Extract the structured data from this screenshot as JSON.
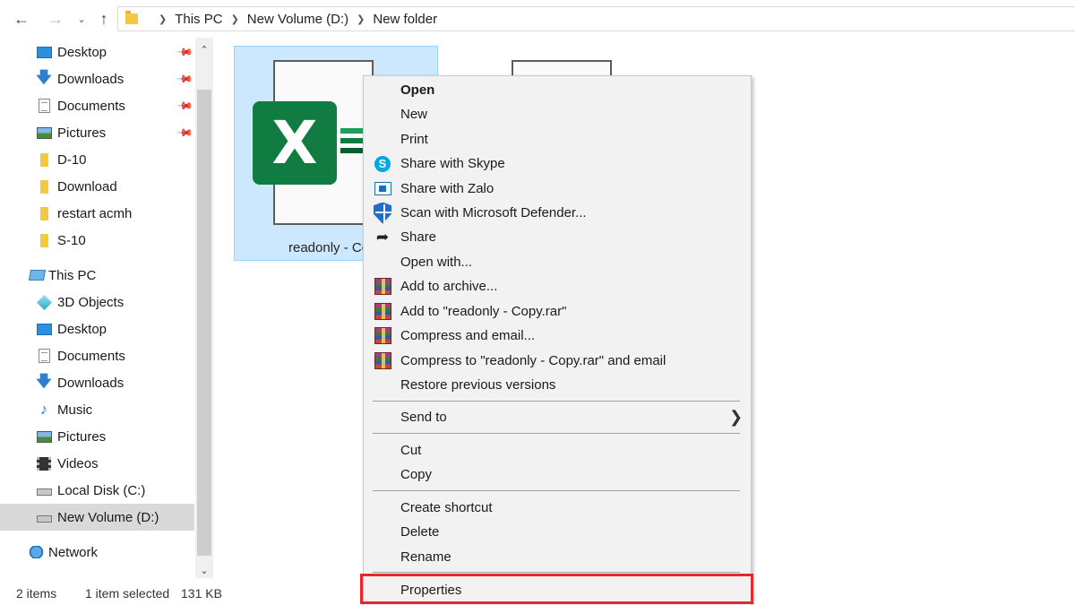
{
  "address_bar": {
    "back_icon": "back-arrow-icon",
    "forward_icon": "forward-arrow-icon",
    "up_icon": "up-arrow-icon",
    "breadcrumbs": [
      "This PC",
      "New Volume (D:)",
      "New folder"
    ]
  },
  "nav_pane": {
    "quick_access": [
      {
        "label": "Desktop",
        "icon": "desktop-icon",
        "pinned": true
      },
      {
        "label": "Downloads",
        "icon": "downloads-icon",
        "pinned": true
      },
      {
        "label": "Documents",
        "icon": "documents-icon",
        "pinned": true
      },
      {
        "label": "Pictures",
        "icon": "pictures-icon",
        "pinned": true
      },
      {
        "label": "D-10",
        "icon": "folder-icon",
        "pinned": false
      },
      {
        "label": "Download",
        "icon": "folder-icon",
        "pinned": false
      },
      {
        "label": "restart acmh",
        "icon": "folder-icon",
        "pinned": false
      },
      {
        "label": "S-10",
        "icon": "folder-icon",
        "pinned": false
      }
    ],
    "this_pc": {
      "label": "This PC",
      "icon": "this-pc-icon",
      "children": [
        {
          "label": "3D Objects",
          "icon": "3d-objects-icon"
        },
        {
          "label": "Desktop",
          "icon": "desktop-icon"
        },
        {
          "label": "Documents",
          "icon": "documents-icon"
        },
        {
          "label": "Downloads",
          "icon": "downloads-icon"
        },
        {
          "label": "Music",
          "icon": "music-icon"
        },
        {
          "label": "Pictures",
          "icon": "pictures-icon"
        },
        {
          "label": "Videos",
          "icon": "videos-icon"
        },
        {
          "label": "Local Disk (C:)",
          "icon": "local-disk-icon"
        },
        {
          "label": "New Volume (D:)",
          "icon": "drive-icon",
          "selected": true
        }
      ]
    },
    "network": {
      "label": "Network",
      "icon": "network-icon"
    }
  },
  "content": {
    "selected_file": {
      "name": "readonly - Co",
      "icon": "excel-file-icon",
      "badge_letter": "X"
    }
  },
  "context_menu": {
    "groups": [
      [
        {
          "label": "Open",
          "bold": true,
          "icon": null
        },
        {
          "label": "New",
          "icon": null
        },
        {
          "label": "Print",
          "icon": null
        },
        {
          "label": "Share with Skype",
          "icon": "skype-icon"
        },
        {
          "label": "Share with Zalo",
          "icon": "zalo-icon"
        },
        {
          "label": "Scan with Microsoft Defender...",
          "icon": "defender-shield-icon"
        },
        {
          "label": "Share",
          "icon": "share-icon"
        },
        {
          "label": "Open with...",
          "icon": null
        },
        {
          "label": "Add to archive...",
          "icon": "winrar-icon"
        },
        {
          "label": "Add to \"readonly - Copy.rar\"",
          "icon": "winrar-icon"
        },
        {
          "label": "Compress and email...",
          "icon": "winrar-icon"
        },
        {
          "label": "Compress to \"readonly - Copy.rar\" and email",
          "icon": "winrar-icon"
        },
        {
          "label": "Restore previous versions",
          "icon": null
        }
      ],
      [
        {
          "label": "Send to",
          "icon": null,
          "submenu": true
        }
      ],
      [
        {
          "label": "Cut",
          "icon": null
        },
        {
          "label": "Copy",
          "icon": null
        }
      ],
      [
        {
          "label": "Create shortcut",
          "icon": null
        },
        {
          "label": "Delete",
          "icon": null
        },
        {
          "label": "Rename",
          "icon": null
        }
      ],
      [
        {
          "label": "Properties",
          "icon": null,
          "highlighted": true
        }
      ]
    ],
    "highlight_color": "#e8262b"
  },
  "status_bar": {
    "items_count": "2 items",
    "selection": "1 item selected",
    "size": "131 KB"
  }
}
